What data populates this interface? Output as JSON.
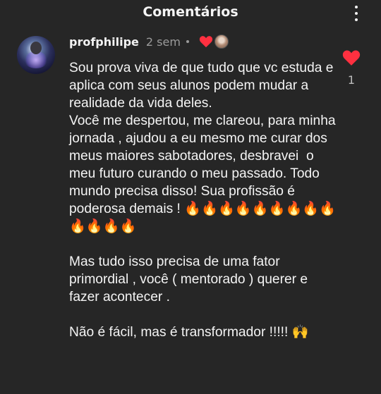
{
  "header": {
    "title": "Comentários",
    "menu_icon": "kebab-menu-icon"
  },
  "comment": {
    "username": "profphilipe",
    "time": "2 sem",
    "liked_by_creator": true,
    "paragraphs": [
      "Sou prova viva de que tudo que vc estuda e aplica com seus alunos podem mudar a realidade da vida deles.",
      "Você me despertou, me clareou, para minha jornada , ajudou a eu mesmo me curar dos meus maiores sabotadores, desbravei  o meu futuro curando o meu passado. Todo mundo precisa disso! Sua profissão é poderosa demais ! 🔥🔥🔥🔥🔥🔥🔥🔥🔥🔥🔥🔥🔥",
      "",
      "Mas tudo isso precisa de uma fator primordial , você ( mentorado ) querer e fazer acontecer .",
      "",
      "Não é fácil, mas é transformador !!!!! 🙌"
    ],
    "like_count": "1",
    "like_color": "#ff3040"
  }
}
